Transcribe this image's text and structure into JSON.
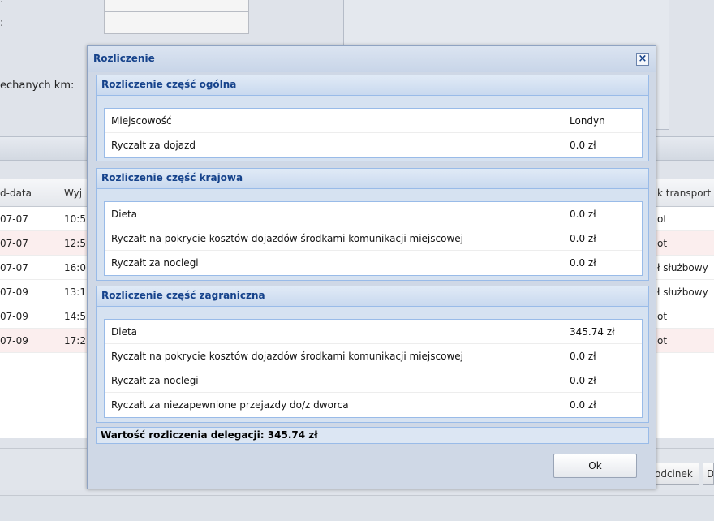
{
  "background": {
    "form_labels": [
      ":",
      ":",
      "echanych km:"
    ],
    "grid": {
      "headers": [
        "d-data",
        "Wyj",
        "k transport"
      ],
      "rows": [
        {
          "date": "07-07",
          "time": "10:5",
          "transport": "ot"
        },
        {
          "date": "07-07",
          "time": "12:5",
          "transport": "ot"
        },
        {
          "date": "07-07",
          "time": "16:0",
          "transport": "ł służbowy"
        },
        {
          "date": "07-09",
          "time": "13:1",
          "transport": "ł służbowy"
        },
        {
          "date": "07-09",
          "time": "14:5",
          "transport": "ot"
        },
        {
          "date": "07-09",
          "time": "17:2",
          "transport": "ot"
        }
      ]
    },
    "buttons": [
      "odcinek",
      "D"
    ]
  },
  "dialog": {
    "title": "Rozliczenie",
    "close_icon": "close-icon",
    "sections": [
      {
        "title": "Rozliczenie część ogólna",
        "rows": [
          {
            "label": "Miejscowość",
            "value": "Londyn"
          },
          {
            "label": "Ryczałt za dojazd",
            "value": "0.0 zł"
          }
        ]
      },
      {
        "title": "Rozliczenie część krajowa",
        "rows": [
          {
            "label": "Dieta",
            "value": "0.0 zł"
          },
          {
            "label": "Ryczałt na pokrycie kosztów dojazdów środkami komunikacji miejscowej",
            "value": "0.0 zł"
          },
          {
            "label": "Ryczałt za noclegi",
            "value": "0.0 zł"
          }
        ]
      },
      {
        "title": "Rozliczenie część zagraniczna",
        "rows": [
          {
            "label": "Dieta",
            "value": "345.74 zł"
          },
          {
            "label": "Ryczałt na pokrycie kosztów dojazdów środkami komunikacji miejscowej",
            "value": "0.0 zł"
          },
          {
            "label": "Ryczałt za noclegi",
            "value": "0.0 zł"
          },
          {
            "label": "Ryczałt za niezapewnione przejazdy do/z dworca",
            "value": "0.0 zł"
          }
        ]
      }
    ],
    "total": "Wartość rozliczenia delegacji: 345.74 zł",
    "ok_label": "Ok"
  },
  "colors": {
    "title_text": "#15428b",
    "section_border": "#99bbe8",
    "alt_row": "#fbeeee"
  }
}
